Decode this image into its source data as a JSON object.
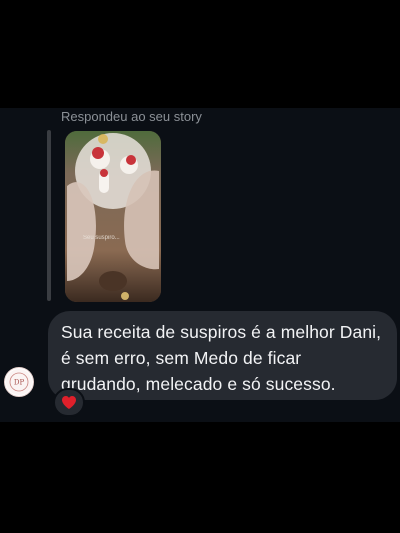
{
  "reply": {
    "label": "Respondeu ao seu story",
    "story_caption": "Seu suspiro..."
  },
  "message": {
    "lines": [
      "Sua receita de suspiros é a melhor Dani,",
      "é sem erro, sem Medo de ficar",
      "grudando, melecado e só sucesso."
    ]
  },
  "avatar": {
    "icon": "profile-logo-icon"
  },
  "reaction": {
    "icon": "heart-icon",
    "color": "#e0202b"
  },
  "colors": {
    "background": "#000000",
    "chat_background": "#0b0f15",
    "bubble": "#262a31",
    "text": "#f2f3f5",
    "muted_text": "#8b9096"
  }
}
